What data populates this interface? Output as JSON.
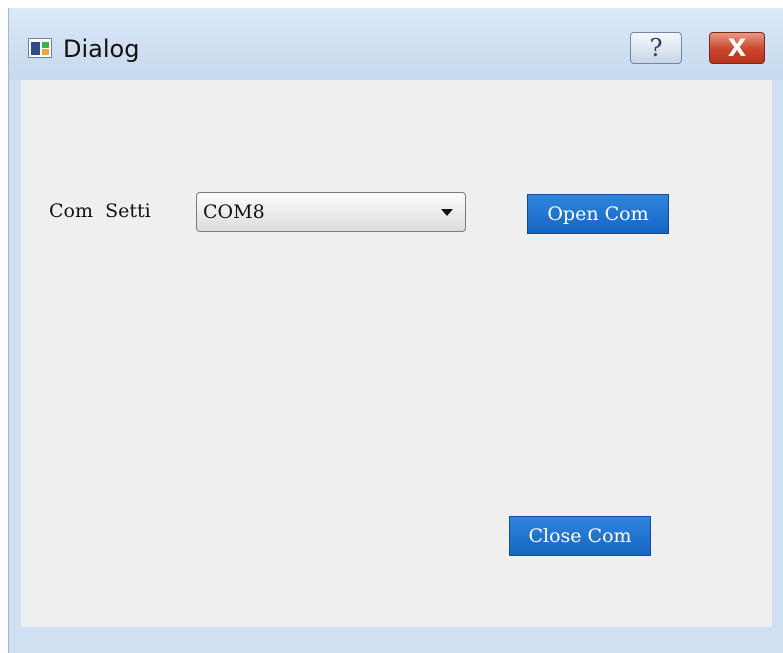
{
  "window": {
    "title": "Dialog",
    "help_label": "?",
    "close_label": "X"
  },
  "form": {
    "com_label": "Com  Setti",
    "com_select": {
      "selected": "COM8"
    },
    "open_button_label": "Open Com",
    "close_button_label": "Close Com"
  },
  "colors": {
    "button_blue": "#1a6fc9",
    "client_background": "#efefef",
    "titlebar": "#cfe0f3",
    "close_red": "#c9452c"
  },
  "icons": {
    "app": "dialog-window-icon",
    "help": "question-mark-icon",
    "close": "close-x-icon",
    "dropdown": "chevron-down-icon"
  }
}
